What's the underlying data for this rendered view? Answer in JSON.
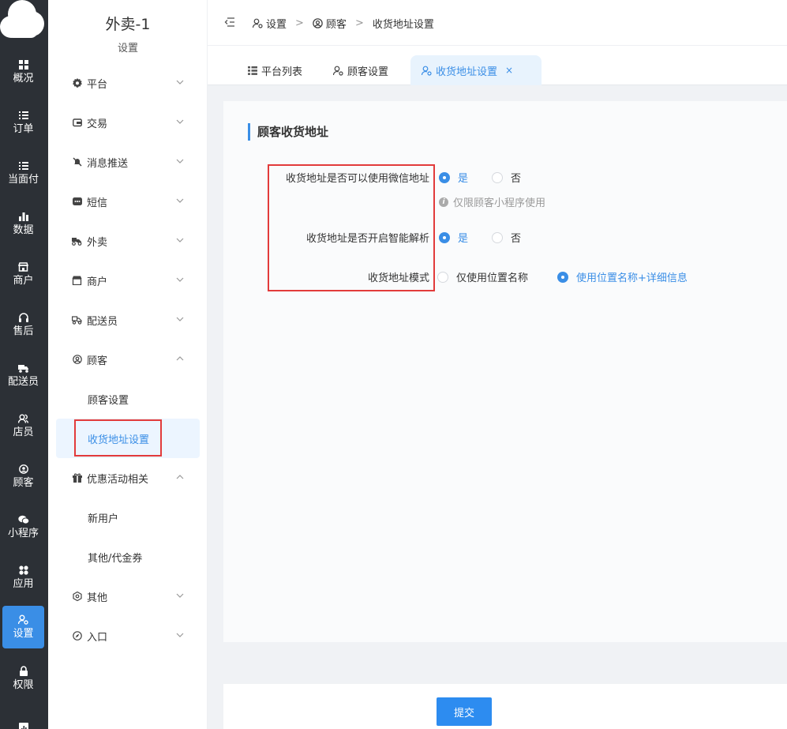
{
  "rail": {
    "items": [
      {
        "label": "概况",
        "icon": "grid-icon"
      },
      {
        "label": "订单",
        "icon": "list-icon"
      },
      {
        "label": "当面付",
        "icon": "list-icon"
      },
      {
        "label": "数据",
        "icon": "bar-chart-icon"
      },
      {
        "label": "商户",
        "icon": "store-icon"
      },
      {
        "label": "售后",
        "icon": "headset-icon"
      },
      {
        "label": "配送员",
        "icon": "delivery-icon"
      },
      {
        "label": "店员",
        "icon": "users-icon"
      },
      {
        "label": "顾客",
        "icon": "user-circle-icon"
      },
      {
        "label": "小程序",
        "icon": "wechat-icon"
      },
      {
        "label": "应用",
        "icon": "apps-icon"
      },
      {
        "label": "设置",
        "icon": "user-gear-icon"
      },
      {
        "label": "权限",
        "icon": "lock-icon"
      }
    ]
  },
  "submenu": {
    "shop_name": "外卖-1",
    "subtitle": "设置",
    "items": [
      {
        "label": "平台"
      },
      {
        "label": "交易"
      },
      {
        "label": "消息推送"
      },
      {
        "label": "短信"
      },
      {
        "label": "外卖"
      },
      {
        "label": "商户"
      },
      {
        "label": "配送员"
      },
      {
        "label": "顾客"
      },
      {
        "label": "优惠活动相关"
      },
      {
        "label": "其他"
      },
      {
        "label": "入口"
      }
    ],
    "customer_children": [
      "顾客设置",
      "收货地址设置"
    ],
    "promo_children": [
      "新用户",
      "其他/代金券"
    ]
  },
  "breadcrumb": {
    "items": [
      "设置",
      "顾客",
      "收货地址设置"
    ],
    "separator": ">"
  },
  "tabs": {
    "items": [
      {
        "label": "平台列表"
      },
      {
        "label": "顾客设置"
      },
      {
        "label": "收货地址设置"
      }
    ],
    "close": "×"
  },
  "form": {
    "title": "顾客收货地址",
    "wechat_label": "收货地址是否可以使用微信地址",
    "wechat_yes": "是",
    "wechat_no": "否",
    "wechat_hint": "仅限顾客小程序使用",
    "smart_label": "收货地址是否开启智能解析",
    "smart_yes": "是",
    "smart_no": "否",
    "mode_label": "收货地址模式",
    "mode_opt1": "仅使用位置名称",
    "mode_opt2": "使用位置名称+详细信息"
  },
  "footer": {
    "submit": "提交"
  },
  "colors": {
    "accent": "#3a8ee6",
    "rail_bg": "#2c3036",
    "highlight": "#e23b3b"
  }
}
